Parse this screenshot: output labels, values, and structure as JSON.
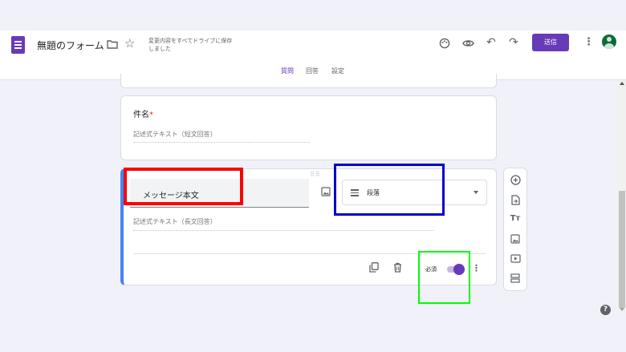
{
  "header": {
    "form_title": "無題のフォーム",
    "save_status": "変更内容をすべてドライブに保存しました",
    "send_label": "送信",
    "icons": [
      "folder-icon",
      "star-icon",
      "palette-icon",
      "eye-icon",
      "undo-icon",
      "redo-icon",
      "more-vert-icon",
      "account-avatar"
    ]
  },
  "tabs": [
    {
      "label": "質問",
      "active": true
    },
    {
      "label": "回答",
      "active": false
    },
    {
      "label": "設定",
      "active": false
    }
  ],
  "question1": {
    "title": "件名",
    "required_mark": "*",
    "answer_hint": "記述式テキスト（短文回答）"
  },
  "question2": {
    "title": "メッセージ本文",
    "type": "段落",
    "answer_hint": "記述式テキスト（長文回答）",
    "required_label": "必須",
    "required": true
  },
  "side_toolbar": [
    "add-question-icon",
    "import-questions-icon",
    "add-title-icon",
    "add-image-icon",
    "add-video-icon",
    "add-section-icon"
  ],
  "colors": {
    "accent": "#673ab7",
    "active_card_border": "#4285f4",
    "highlight_red": "#ff0000",
    "highlight_blue": "#0000cc",
    "highlight_green": "#00ff00"
  }
}
